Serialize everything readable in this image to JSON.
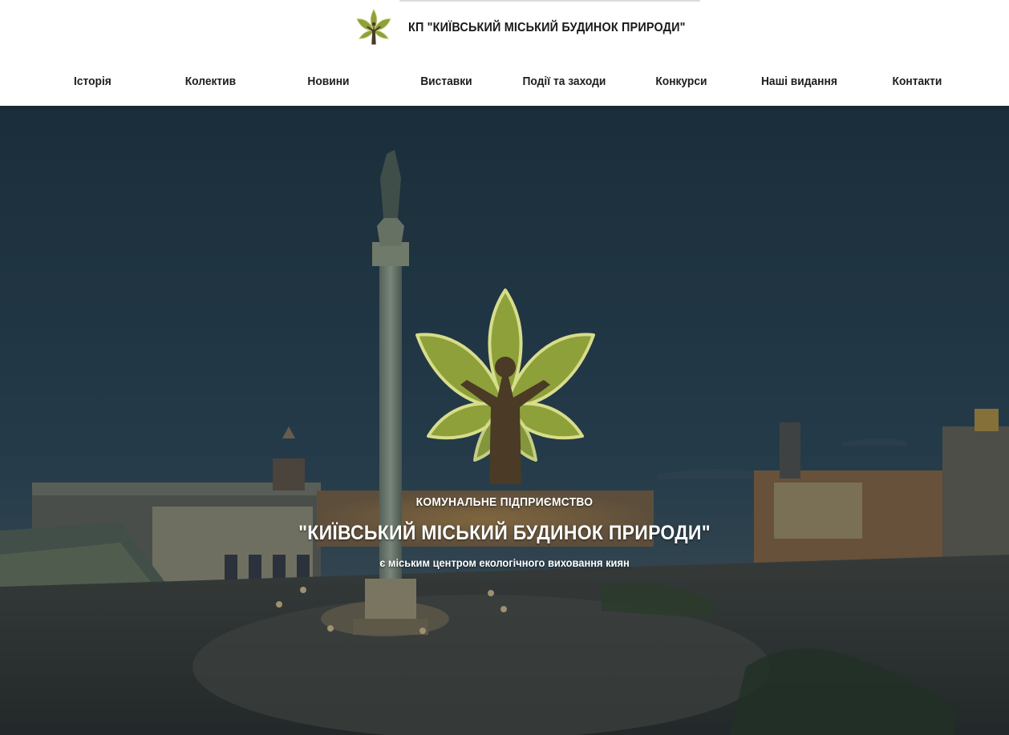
{
  "header": {
    "title": "КП \"КИЇВСЬКИЙ МІСЬКИЙ БУДИНОК ПРИРОДИ\"",
    "logo_icon": "chestnut-leaf-tree-icon"
  },
  "nav": {
    "items": [
      {
        "label": "Історія"
      },
      {
        "label": "Колектив"
      },
      {
        "label": "Новини"
      },
      {
        "label": "Виставки"
      },
      {
        "label": "Події та заходи"
      },
      {
        "label": "Конкурси"
      },
      {
        "label": "Наші видання"
      },
      {
        "label": "Контакти"
      }
    ]
  },
  "hero": {
    "line1": "КОМУНАЛЬНЕ ПІДПРИЄМСТВО",
    "line2": "\"КИЇВСЬКИЙ МІСЬКИЙ БУДИНОК ПРИРОДИ\"",
    "line3": "є міським центром екологічного виховання киян",
    "logo_icon": "chestnut-leaf-tree-icon",
    "background": "independence-square-night-photo"
  },
  "colors": {
    "leaf_green": "#8ea03a",
    "leaf_outline": "#d7dd8a",
    "trunk_brown": "#4a3a26",
    "sky": "#284050"
  }
}
